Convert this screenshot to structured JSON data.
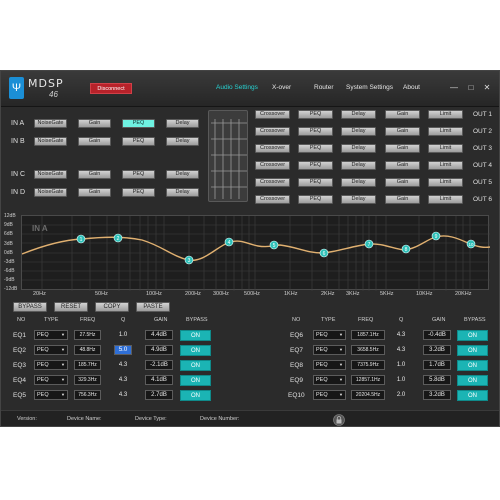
{
  "titlebar": {
    "brand": "MDSP",
    "model": "46",
    "disconnect": "Disconnect",
    "nav": [
      "Audio Settings",
      "X-over",
      "Router",
      "System Settings",
      "About"
    ],
    "window_controls": [
      "—",
      "□",
      "✕"
    ]
  },
  "inputs": [
    {
      "label": "IN A",
      "buttons": [
        "NoiseGate",
        "Gain",
        "PEQ",
        "Delay"
      ]
    },
    {
      "label": "IN B",
      "buttons": [
        "NoiseGate",
        "Gain",
        "PEQ",
        "Delay"
      ]
    },
    {
      "label": "IN C",
      "buttons": [
        "NoiseGate",
        "Gain",
        "PEQ",
        "Delay"
      ]
    },
    {
      "label": "IN D",
      "buttons": [
        "NoiseGate",
        "Gain",
        "PEQ",
        "Delay"
      ]
    }
  ],
  "outputs": [
    {
      "label": "OUT 1",
      "buttons": [
        "Crossover",
        "PEQ",
        "Delay",
        "Gain",
        "Limit"
      ]
    },
    {
      "label": "OUT 2",
      "buttons": [
        "Crossover",
        "PEQ",
        "Delay",
        "Gain",
        "Limit"
      ]
    },
    {
      "label": "OUT 3",
      "buttons": [
        "Crossover",
        "PEQ",
        "Delay",
        "Gain",
        "Limit"
      ]
    },
    {
      "label": "OUT 4",
      "buttons": [
        "Crossover",
        "PEQ",
        "Delay",
        "Gain",
        "Limit"
      ]
    },
    {
      "label": "OUT 5",
      "buttons": [
        "Crossover",
        "PEQ",
        "Delay",
        "Gain",
        "Limit"
      ]
    },
    {
      "label": "OUT 6",
      "buttons": [
        "Crossover",
        "PEQ",
        "Delay",
        "Gain",
        "Limit"
      ]
    }
  ],
  "graph": {
    "title": "IN A",
    "y_labels": [
      "12dB",
      "9dB",
      "6dB",
      "3dB",
      "0dB",
      "-3dB",
      "-6dB",
      "-9dB",
      "-12dB"
    ],
    "x_labels": [
      "20Hz",
      "50Hz",
      "100Hz",
      "200Hz",
      "300Hz",
      "500Hz",
      "1KHz",
      "2KHz",
      "3KHz",
      "5KHz",
      "10KHz",
      "20KHz"
    ],
    "markers": [
      "1",
      "2",
      "3",
      "4",
      "5",
      "6",
      "7",
      "8",
      "9",
      "10"
    ],
    "curve_color": "#e0b070",
    "marker_color": "#2fc0b8"
  },
  "actions": [
    "BYPASS",
    "RESET",
    "COPY",
    "PASTE"
  ],
  "headers": [
    "NO",
    "TYPE",
    "FREQ",
    "Q",
    "GAIN",
    "BYPASS"
  ],
  "eq_left": [
    {
      "no": "EQ1",
      "type": "PEQ",
      "freq": "27.5Hz",
      "q": "1.0",
      "gain": "4.4dB",
      "bypass": "ON"
    },
    {
      "no": "EQ2",
      "type": "PEQ",
      "freq": "48.8Hz",
      "q": "5.0",
      "gain": "4.9dB",
      "bypass": "ON"
    },
    {
      "no": "EQ3",
      "type": "PEQ",
      "freq": "185.7Hz",
      "q": "4.3",
      "gain": "-2.1dB",
      "bypass": "ON"
    },
    {
      "no": "EQ4",
      "type": "PEQ",
      "freq": "329.3Hz",
      "q": "4.3",
      "gain": "4.1dB",
      "bypass": "ON"
    },
    {
      "no": "EQ5",
      "type": "PEQ",
      "freq": "756.3Hz",
      "q": "4.3",
      "gain": "2.7dB",
      "bypass": "ON"
    }
  ],
  "eq_right": [
    {
      "no": "EQ6",
      "type": "PEQ",
      "freq": "1857.1Hz",
      "q": "4.3",
      "gain": "-0.4dB",
      "bypass": "ON"
    },
    {
      "no": "EQ7",
      "type": "PEQ",
      "freq": "3658.5Hz",
      "q": "4.3",
      "gain": "3.2dB",
      "bypass": "ON"
    },
    {
      "no": "EQ8",
      "type": "PEQ",
      "freq": "7375.9Hz",
      "q": "1.0",
      "gain": "1.7dB",
      "bypass": "ON"
    },
    {
      "no": "EQ9",
      "type": "PEQ",
      "freq": "12857.1Hz",
      "q": "1.0",
      "gain": "5.8dB",
      "bypass": "ON"
    },
    {
      "no": "EQ10",
      "type": "PEQ",
      "freq": "20204.5Hz",
      "q": "2.0",
      "gain": "3.2dB",
      "bypass": "ON"
    }
  ],
  "status": [
    "Version:",
    "Device Name:",
    "Device Type:",
    "Device Number:"
  ],
  "colors": {
    "accent": "#27d3d3",
    "disconnect": "#b8222a",
    "on_button": "#1bb4b4"
  }
}
